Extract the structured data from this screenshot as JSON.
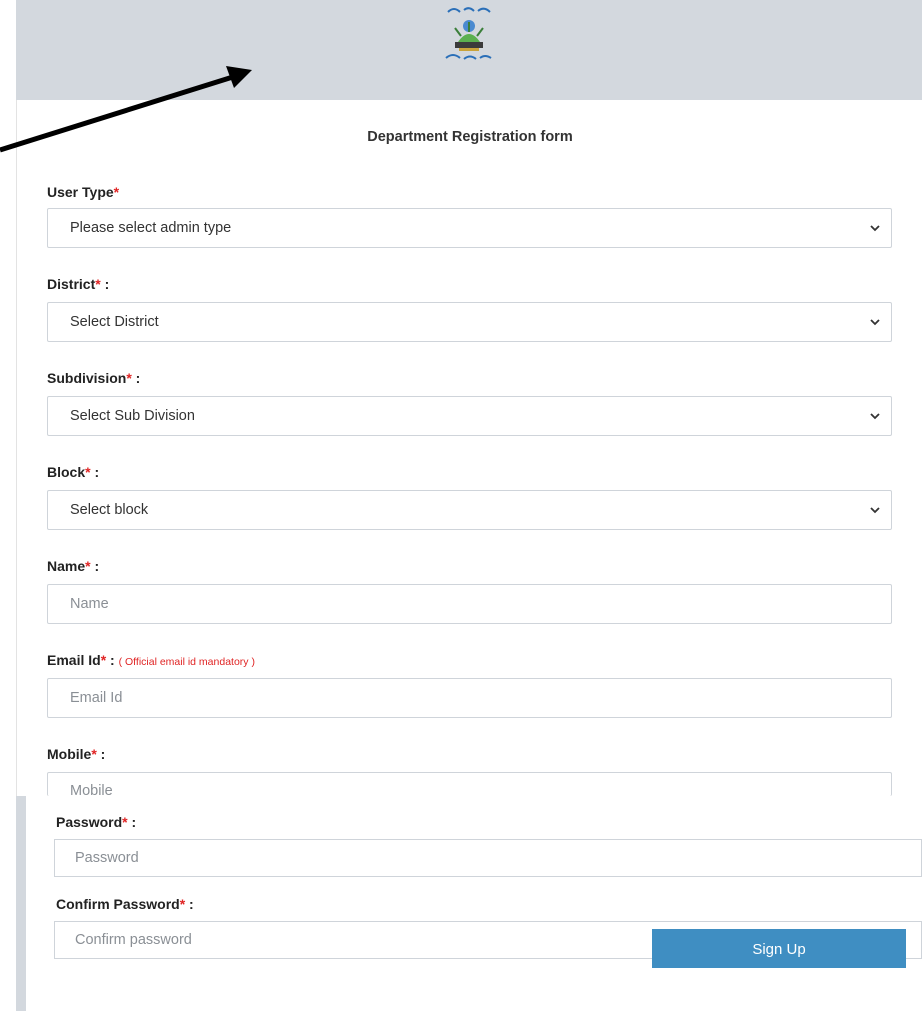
{
  "form": {
    "title": "Department Registration form"
  },
  "fields": {
    "user_type": {
      "label": "User Type",
      "req": "*",
      "value": "Please select admin type"
    },
    "district": {
      "label": "District",
      "req": "*",
      "colon": " :",
      "value": "Select District"
    },
    "subdivision": {
      "label": "Subdivision",
      "req": "*",
      "colon": " :",
      "value": "Select Sub Division"
    },
    "block": {
      "label": "Block",
      "req": "*",
      "colon": " :",
      "value": "Select block"
    },
    "name": {
      "label": "Name",
      "req": "*",
      "colon": " :",
      "placeholder": "Name"
    },
    "email": {
      "label": "Email Id",
      "req": "*",
      "colon": " :",
      "note": "( Official email id mandatory )",
      "placeholder": "Email Id"
    },
    "mobile": {
      "label": "Mobile",
      "req": "*",
      "colon": " :",
      "placeholder": "Mobile"
    },
    "password": {
      "label": "Password",
      "req": "*",
      "colon": " :",
      "placeholder": "Password"
    },
    "confirm_password": {
      "label": "Confirm Password",
      "req": "*",
      "colon": " :",
      "placeholder": "Confirm password"
    }
  },
  "buttons": {
    "signup": "Sign Up"
  },
  "icons": {
    "logo": "emblem-logo",
    "dropdown": "chevron-down-icon",
    "pointer": "arrow-annotation"
  },
  "colors": {
    "header_bg": "#d3d8de",
    "required": "#e02424",
    "button": "#3f8ec2"
  }
}
